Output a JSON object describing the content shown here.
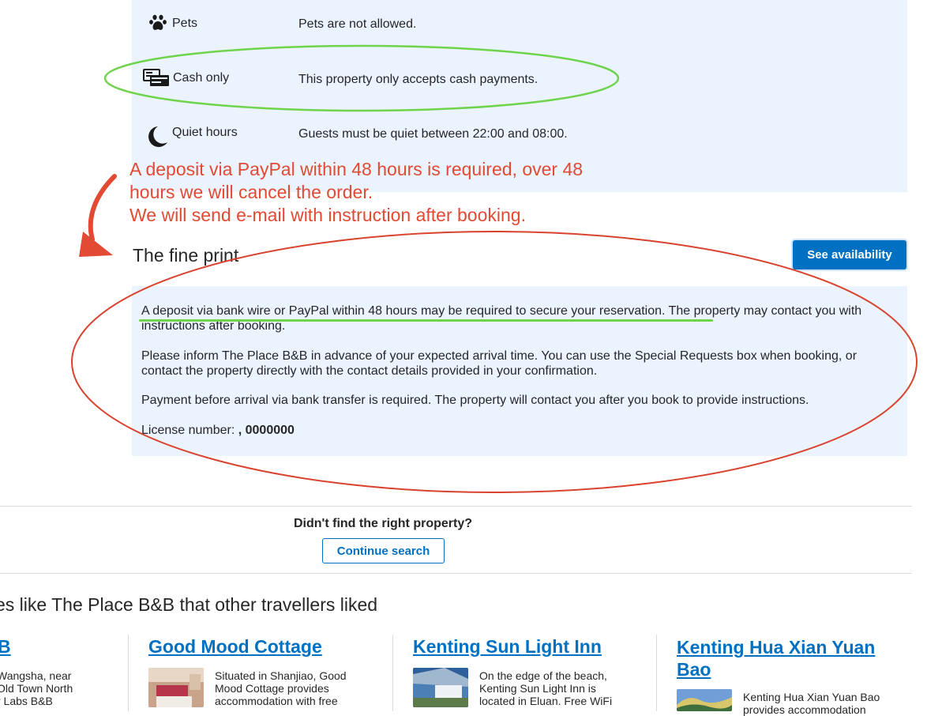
{
  "house_rules": {
    "rows": [
      {
        "icon": "paw-icon",
        "label": "Pets",
        "text": "Pets are not allowed."
      },
      {
        "icon": "cash-icon",
        "label": "Cash only",
        "text": "This property only accepts cash payments."
      },
      {
        "icon": "moon-icon",
        "label": "Quiet hours",
        "text": "Guests must be quiet between 22:00 and 08:00."
      }
    ]
  },
  "annotation": {
    "line1": "A deposit via PayPal within 48 hours is required, over 48",
    "line2": "hours we will cancel the order.",
    "line3": "We will send e-mail with instruction after booking.",
    "color": "#e24a33",
    "highlight_color": "#6fd34b"
  },
  "fine_print": {
    "title": "The fine print",
    "see_availability": "See availability",
    "p1_highlight": "A deposit via bank wire or PayPal within 48 hours may be required to secure your reservation",
    "p1_rest": ". The property may contact you with instructions after booking.",
    "p2": "Please inform The Place B&B in advance of your expected arrival time. You can use the Special Requests box when booking, or contact the property directly with the contact details provided in your confirmation.",
    "p3": "Payment before arrival via bank transfer is required. The property will contact you after you book to provide instructions.",
    "license_label": "License number: ",
    "license_value": ", 0000000"
  },
  "search": {
    "question": "Didn't find the right property?",
    "continue_label": "Continue search"
  },
  "similar": {
    "heading": "erties like The Place B&B that other travellers liked",
    "cards": [
      {
        "title": "B",
        "desc_lines": [
          "Wangsha, near",
          "Old Town North",
          "r Labs B&B"
        ]
      },
      {
        "title": "Good Mood Cottage",
        "desc_lines": [
          "Situated in Shanjiao, Good",
          "Mood Cottage provides",
          "accommodation with free"
        ]
      },
      {
        "title": "Kenting Sun Light Inn",
        "desc_lines": [
          "On the edge of the beach,",
          "Kenting Sun Light Inn is",
          "located in Eluan. Free WiFi"
        ]
      },
      {
        "title_lines": [
          "Kenting Hua Xian Yuan",
          "Bao"
        ],
        "desc_lines": [
          "Kenting Hua Xian Yuan Bao",
          "provides accommodation"
        ]
      }
    ]
  },
  "colors": {
    "brand_blue": "#0071c2",
    "panel_bg": "#ebf3ff"
  }
}
